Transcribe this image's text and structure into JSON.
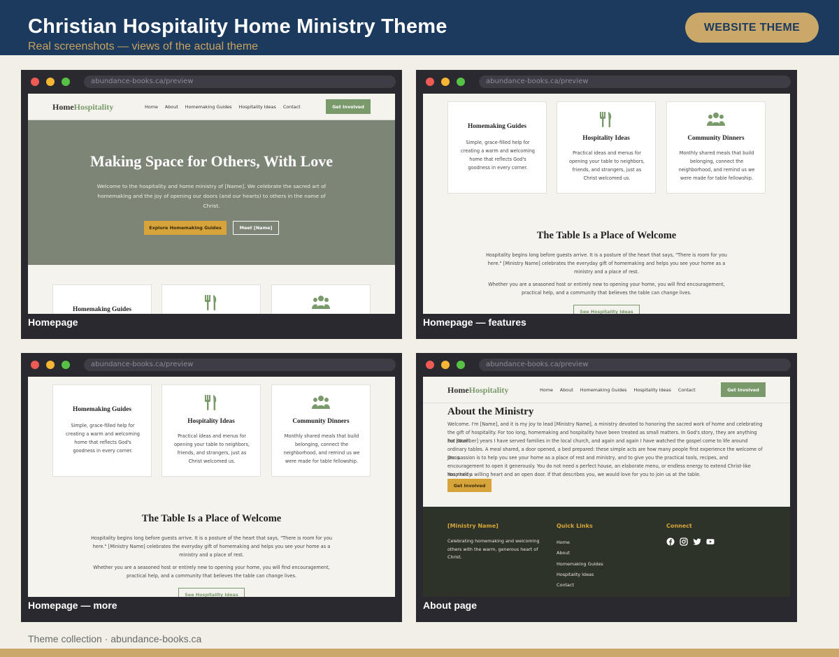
{
  "banner": {
    "title": "Christian Hospitality Home Ministry Theme",
    "subtitle": "Real screenshots — views of the actual theme",
    "badge": "WEBSITE THEME"
  },
  "browser": {
    "url": "abundance-books.ca/preview"
  },
  "site": {
    "logo_part1": "Home",
    "logo_part2": "Hospitality",
    "nav": [
      "Home",
      "About",
      "Homemaking Guides",
      "Hospitality Ideas",
      "Contact"
    ],
    "nav_button": "Get Involved"
  },
  "hero": {
    "title": "Making Space for Others, With Love",
    "text": "Welcome to the hospitality and home ministry of [Name]. We celebrate the sacred art of homemaking and the joy of opening our doors (and our hearts) to others in the name of Christ.",
    "btn_primary": "Explore Homemaking Guides",
    "btn_secondary": "Meet [Name]"
  },
  "cards": [
    {
      "title": "Homemaking Guides",
      "text": "Simple, grace-filled help for creating a warm and welcoming home that reflects God's goodness in every corner.",
      "icon": "none"
    },
    {
      "title": "Hospitality Ideas",
      "text": "Practical ideas and menus for opening your table to neighbors, friends, and strangers, just as Christ welcomed us.",
      "icon": "utensils-icon"
    },
    {
      "title": "Community Dinners",
      "text": "Monthly shared meals that build belonging, connect the neighborhood, and remind us we were made for table fellowship.",
      "icon": "people-group-icon"
    }
  ],
  "welcome": {
    "title": "The Table Is a Place of Welcome",
    "p1": "Hospitality begins long before guests arrive. It is a posture of the heart that says, \"There is room for you here.\" [Ministry Name] celebrates the everyday gift of homemaking and helps you see your home as a ministry and a place of rest.",
    "p2": "Whether you are a seasoned host or entirely new to opening your home, you will find encouragement, practical help, and a community that believes the table can change lives.",
    "button": "See Hospitality Ideas"
  },
  "about": {
    "title": "About the Ministry",
    "p1": "Welcome. I'm [Name], and it is my joy to lead [Ministry Name], a ministry devoted to honoring the sacred work of home and celebrating the gift of hospitality. For too long, homemaking and hospitality have been treated as small matters. In God's story, they are anything but small.",
    "p2": "For [Number] years I have served families in the local church, and again and again I have watched the gospel come to life around ordinary tables. A meal shared, a door opened, a bed prepared: these simple acts are how many people first experience the welcome of Jesus.",
    "p3": "Our passion is to help you see your home as a place of rest and ministry, and to give you the practical tools, recipes, and encouragement to open it generously. You do not need a perfect house, an elaborate menu, or endless energy to extend Christ-like hospitality.",
    "p4": "You need a willing heart and an open door. If that describes you, we would love for you to join us at the table.",
    "button": "Get Involved"
  },
  "footer": {
    "col1_head": "[Ministry Name]",
    "col1_text": "Celebrating homemaking and welcoming others with the warm, generous heart of Christ.",
    "col2_head": "Quick Links",
    "links": [
      "Home",
      "About",
      "Homemaking Guides",
      "Hospitality Ideas",
      "Contact"
    ],
    "col3_head": "Connect",
    "social": [
      "facebook-icon",
      "instagram-icon",
      "twitter-icon",
      "youtube-icon"
    ]
  },
  "captions": [
    "Homepage",
    "Homepage — features",
    "Homepage — more",
    "About page"
  ],
  "credit": "Theme collection · abundance-books.ca",
  "colors": {
    "navy": "#1c3a5e",
    "gold": "#c9a86a",
    "sage": "#7a9a6c",
    "mustard": "#d6a43a",
    "footer": "#2e3329"
  }
}
